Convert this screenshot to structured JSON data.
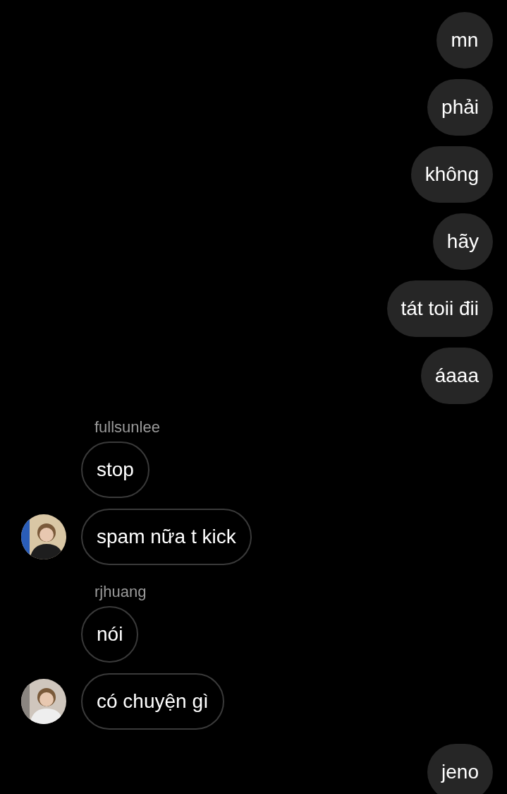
{
  "messages": [
    {
      "kind": "sent",
      "text": "mn"
    },
    {
      "kind": "sent",
      "text": "phải"
    },
    {
      "kind": "sent",
      "text": "không"
    },
    {
      "kind": "sent",
      "text": "hãy"
    },
    {
      "kind": "sent",
      "text": "tát toii đii"
    },
    {
      "kind": "sent",
      "text": "áaaa"
    },
    {
      "kind": "received",
      "sender": "fullsunlee",
      "texts": [
        "stop",
        "spam nữa t kick"
      ]
    },
    {
      "kind": "received",
      "sender": "rjhuang",
      "texts": [
        "nói",
        "có chuyện gì"
      ]
    },
    {
      "kind": "sent",
      "text": "jeno"
    }
  ]
}
